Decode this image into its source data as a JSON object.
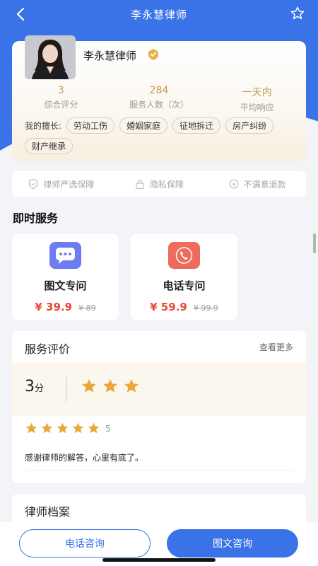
{
  "nav": {
    "title": "李永慧律师",
    "back_icon": "back-arrow-icon",
    "favorite_icon": "star-outline-icon"
  },
  "colors": {
    "primary": "#3a72e8",
    "price": "#e64a3c",
    "gold": "#c29a53"
  },
  "profile": {
    "name": "李永慧律师",
    "badge_icon": "verified-badge-icon",
    "stats": [
      {
        "value": "3",
        "label": "综合评分"
      },
      {
        "value": "284",
        "label": "服务人数（次）"
      },
      {
        "value": "一天内",
        "label": "平均响应"
      }
    ],
    "skills_label": "我的擅长:",
    "skills": [
      "劳动工伤",
      "婚姻家庭",
      "征地拆迁",
      "房产纠纷",
      "财产继承"
    ]
  },
  "guarantees": [
    {
      "icon": "shield-check-icon",
      "label": "律师严选保障"
    },
    {
      "icon": "lock-icon",
      "label": "隐私保障"
    },
    {
      "icon": "refund-icon",
      "label": "不满意退款"
    }
  ],
  "instant_service": {
    "title": "即时服务",
    "items": [
      {
        "icon": "chat-bubble-icon",
        "name": "图文专问",
        "price": "¥ 39.9",
        "original": "¥ 89"
      },
      {
        "icon": "phone-icon",
        "name": "电话专问",
        "price": "¥ 59.9",
        "original": "¥ 99.9"
      }
    ]
  },
  "reviews": {
    "title": "服务评价",
    "more": "查看更多",
    "score": "3",
    "score_unit": "分",
    "score_stars": 3,
    "items": [
      {
        "stars": 5,
        "star_count_label": "5",
        "text": "感谢律师的解答，心里有底了。"
      }
    ]
  },
  "archive": {
    "title": "律师档案"
  },
  "bottom": {
    "phone_button": "电话咨询",
    "text_button": "图文咨询"
  }
}
